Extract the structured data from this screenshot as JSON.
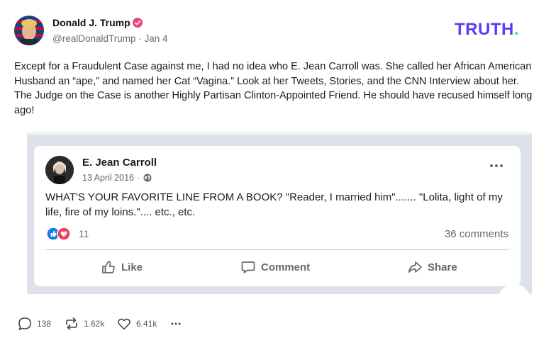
{
  "post": {
    "author_name": "Donald J. Trump",
    "handle": "@realDonaldTrump",
    "separator": " · ",
    "date": "Jan 4",
    "text": "Except for a Fraudulent Case against me, I had no idea who E. Jean Carroll was. She called her African American Husband an “ape,” and named her Cat “Vagina.” Look at her Tweets, Stories, and the CNN Interview about her. The Judge on the Case is another Highly Partisan Clinton-Appointed Friend. He should have recused himself long ago!"
  },
  "logo": {
    "main": "TRUTH",
    "dot": "."
  },
  "embedded_post": {
    "author_name": "E. Jean Carroll",
    "date": "13 April 2016 ·",
    "text": "WHAT'S YOUR FAVORITE LINE FROM A BOOK?  \"Reader, I married him\"....... \"Lolita, light of my life, fire of my loins.\".... etc., etc.",
    "reaction_count": "11",
    "comments": "36 comments",
    "actions": {
      "like": "Like",
      "comment": "Comment",
      "share": "Share"
    }
  },
  "stats": {
    "replies": "138",
    "retruths": "1.62k",
    "likes": "6.41k"
  },
  "colors": {
    "brand": "#5b3df5",
    "brand_dot": "#3fd3c4",
    "verified": "#e64a7d",
    "fb_like_blue": "#1877f2",
    "fb_love_red": "#f33e58"
  },
  "icons": {
    "verified": "verified-badge-icon",
    "globe": "globe-icon",
    "more": "more-horizontal-icon",
    "like": "thumbs-up-icon",
    "comment": "comment-bubble-icon",
    "share": "share-arrow-icon",
    "reply": "reply-bubble-icon",
    "retruth": "retruth-icon",
    "heart": "heart-icon"
  }
}
